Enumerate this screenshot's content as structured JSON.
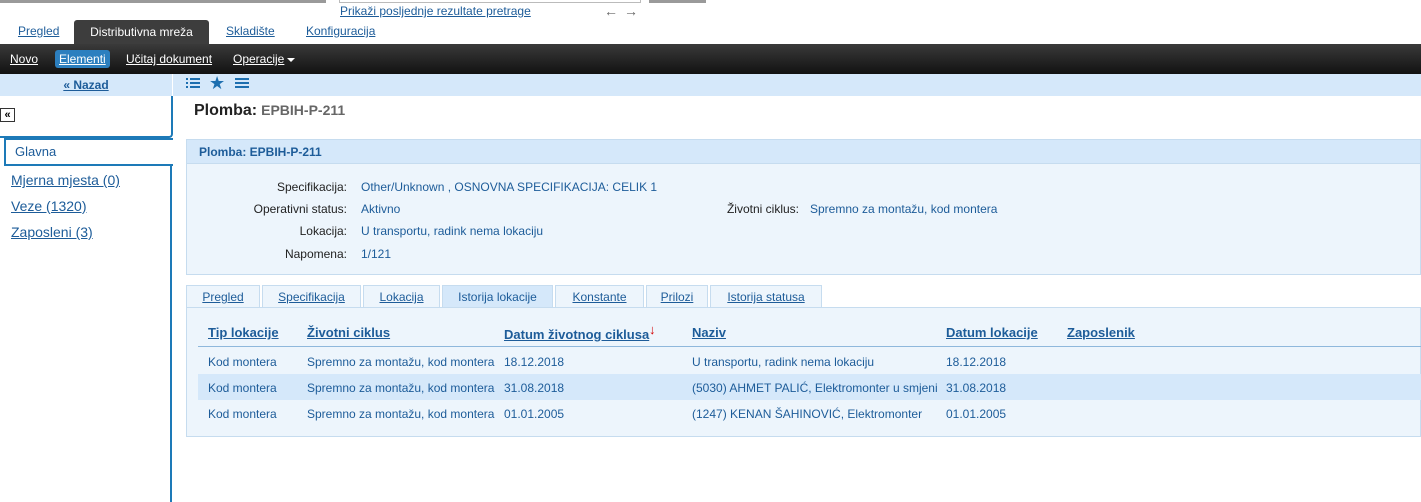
{
  "topbar": {
    "recent_link": "Prikaži posljednje rezultate pretrage",
    "tabs": [
      "Pregled",
      "Distributivna mreža",
      "Skladište",
      "Konfiguracija"
    ],
    "active_tab": "Distributivna mreža"
  },
  "toolbar": {
    "novo": "Novo",
    "elementi": "Elementi",
    "ucitaj": "Učitaj dokument",
    "operacije": "Operacije"
  },
  "sidebar": {
    "back": "« Nazad",
    "items": [
      {
        "label": "Glavna"
      },
      {
        "label": "Mjerna mjesta (0)"
      },
      {
        "label": "Veze (1320)"
      },
      {
        "label": "Zaposleni (3)"
      }
    ]
  },
  "page": {
    "title_prefix": "Plomba:",
    "title_code": "EPBIH-P-211",
    "panel_title": "Plomba: EPBIH-P-211"
  },
  "fields": {
    "specifikacija_label": "Specifikacija:",
    "specifikacija_value": "Other/Unknown , OSNOVNA SPECIFIKACIJA: CELIK 1",
    "operativni_label": "Operativni status:",
    "operativni_value": "Aktivno",
    "lokacija_label": "Lokacija:",
    "lokacija_value": "U transportu, radink nema lokaciju",
    "napomena_label": "Napomena:",
    "napomena_value": "1/121",
    "zivotni_label": "Životni ciklus:",
    "zivotni_value": "Spremno za montažu, kod montera"
  },
  "tabs": [
    "Pregled",
    "Specifikacija",
    "Lokacija",
    "Istorija lokacije",
    "Konstante",
    "Prilozi",
    "Istorija statusa"
  ],
  "active_tab": "Istorija lokacije",
  "table": {
    "columns": [
      "Tip lokacije",
      "Životni ciklus",
      "Datum životnog ciklusa",
      "Naziv",
      "Datum lokacije",
      "Zaposlenik"
    ],
    "sort_indicator": "↓",
    "rows": [
      [
        "Kod montera",
        "Spremno za montažu, kod montera",
        "18.12.2018",
        "U transportu, radink nema lokaciju",
        "18.12.2018",
        ""
      ],
      [
        "Kod montera",
        "Spremno za montažu, kod montera",
        "31.08.2018",
        "(5030) AHMET PALIĆ, Elektromonter u smjeni",
        "31.08.2018",
        ""
      ],
      [
        "Kod montera",
        "Spremno za montažu, kod montera",
        "01.01.2005",
        "(1247) KENAN ŠAHINOVIĆ, Elektromonter",
        "01.01.2005",
        ""
      ]
    ]
  },
  "icons": {
    "list": "list-icon",
    "star": "star-icon",
    "menu": "menu-icon",
    "collapse": "collapse-icon"
  }
}
